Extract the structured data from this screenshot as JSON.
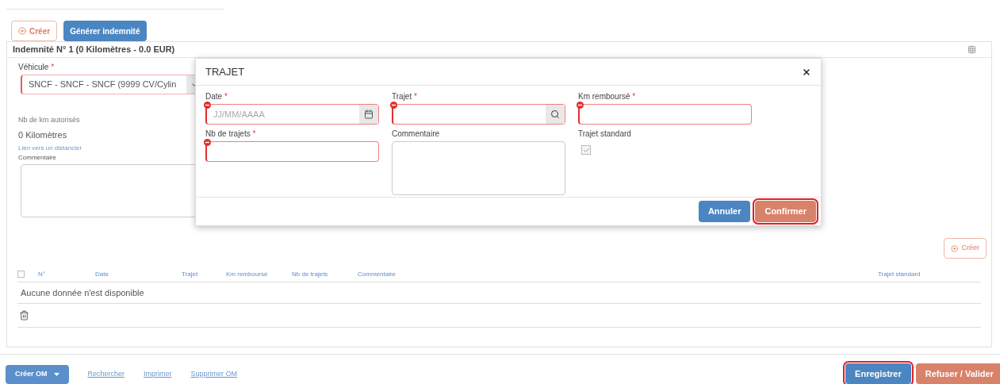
{
  "toolbar": {
    "buttons": [
      {
        "label": "Créer",
        "kind": "outline"
      },
      {
        "label": "Générer indemnité",
        "kind": "primary"
      }
    ]
  },
  "panel": {
    "title": "Indemnité N° 1 (0 Kilomètres - 0.0 EUR)",
    "vehicle": {
      "label": "Véhicule",
      "mark": "*",
      "value": "SNCF - SNCF - SNCF (9999 CV/Cylin",
      "invalid": true
    },
    "km": {
      "label": "Nb de km autorisés",
      "value": "0 Kilomètres"
    },
    "link": "Lien vers un distancier",
    "comment_label": "Commentaire",
    "create_button": "Créer",
    "table": {
      "columns": [
        "N°",
        "Date",
        "Trajet",
        "Km remboursé",
        "Nb de trajets",
        "Commentaire",
        "Trajet standard"
      ],
      "select_all": false,
      "empty_message": "Aucune donnée n'est disponible"
    }
  },
  "dialog": {
    "title": "TRAJET",
    "fields": [
      {
        "kind": "date",
        "label": "Date",
        "mark": "*",
        "placeholder": "JJ/MM/AAAA",
        "invalid": true
      },
      {
        "kind": "search",
        "label": "Trajet",
        "mark": "*",
        "invalid": true
      },
      {
        "kind": "text",
        "label": "Km remboursé",
        "mark": "*",
        "invalid": true
      },
      {
        "kind": "text",
        "label": "Nb de trajets",
        "mark": "*",
        "invalid": true
      },
      {
        "kind": "textarea",
        "label": "Commentaire",
        "invalid": false
      },
      {
        "kind": "checkbox",
        "label": "Trajet standard",
        "checked": true
      }
    ],
    "buttons": [
      {
        "label": "Annuler",
        "kind": "primary",
        "circled": false
      },
      {
        "label": "Confirmer",
        "kind": "danger",
        "circled": true
      }
    ]
  },
  "footer": {
    "menu_button": "Créer OM",
    "links": [
      "Rechercher",
      "Imprimer",
      "Supprimer OM"
    ],
    "buttons": [
      {
        "label": "Enregistrer",
        "kind": "primary",
        "circled": true
      },
      {
        "label": "Refuser / Valider",
        "kind": "danger",
        "circled": false
      }
    ]
  }
}
